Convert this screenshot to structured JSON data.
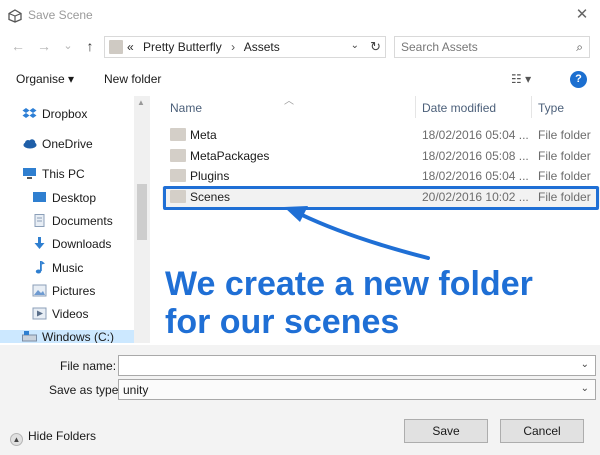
{
  "window": {
    "title": "Save Scene",
    "close_glyph": "✕"
  },
  "nav": {
    "back_glyph": "←",
    "forward_glyph": "→",
    "recent_glyph": "⌄",
    "up_glyph": "↑",
    "breadcrumb_prefix": "«",
    "breadcrumbs": [
      "Pretty Butterfly",
      "Assets"
    ],
    "breadcrumb_sep": "›",
    "dropdown_glyph": "⌄",
    "refresh_glyph": "↻",
    "search_placeholder": "Search Assets",
    "search_icon_glyph": "⌕"
  },
  "toolbar": {
    "organise_label": "Organise ▾",
    "new_folder_label": "New folder",
    "view_glyph": "☷ ▾",
    "help_glyph": "?"
  },
  "sidebar": {
    "items": [
      {
        "label": "Dropbox",
        "icon": "dropbox-icon",
        "color": "#2e7fd6"
      },
      {
        "label": "OneDrive",
        "icon": "cloud-icon",
        "color": "#1f5fa8"
      },
      {
        "label": "This PC",
        "icon": "computer-icon",
        "color": "#2f7fd0"
      },
      {
        "label": "Desktop",
        "icon": "desktop-icon",
        "color": "#2f7fd0"
      },
      {
        "label": "Documents",
        "icon": "documents-icon",
        "color": "#8b9fb8"
      },
      {
        "label": "Downloads",
        "icon": "downloads-icon",
        "color": "#2f7fd0"
      },
      {
        "label": "Music",
        "icon": "music-icon",
        "color": "#2f7fd0"
      },
      {
        "label": "Pictures",
        "icon": "pictures-icon",
        "color": "#8b9fb8"
      },
      {
        "label": "Videos",
        "icon": "videos-icon",
        "color": "#8b9fb8"
      },
      {
        "label": "Windows (C:)",
        "icon": "drive-icon",
        "color": "#7a8ca3"
      }
    ]
  },
  "files": {
    "columns": [
      "Name",
      "Date modified",
      "Type"
    ],
    "rows": [
      {
        "name": "Meta",
        "date": "18/02/2016 05:04 ...",
        "type": "File folder"
      },
      {
        "name": "MetaPackages",
        "date": "18/02/2016 05:08 ...",
        "type": "File folder"
      },
      {
        "name": "Plugins",
        "date": "18/02/2016 05:04 ...",
        "type": "File folder"
      },
      {
        "name": "Scenes",
        "date": "20/02/2016 10:02 ...",
        "type": "File folder"
      }
    ]
  },
  "annotation": {
    "line1": "We create a new folder",
    "line2": "for our scenes",
    "color": "#1f6fd5"
  },
  "form": {
    "file_name_label": "File name:",
    "file_name_value": "",
    "save_as_type_label": "Save as type:",
    "save_as_type_value": "unity"
  },
  "footer": {
    "hide_folders_label": "Hide Folders",
    "save_label": "Save",
    "cancel_label": "Cancel"
  }
}
